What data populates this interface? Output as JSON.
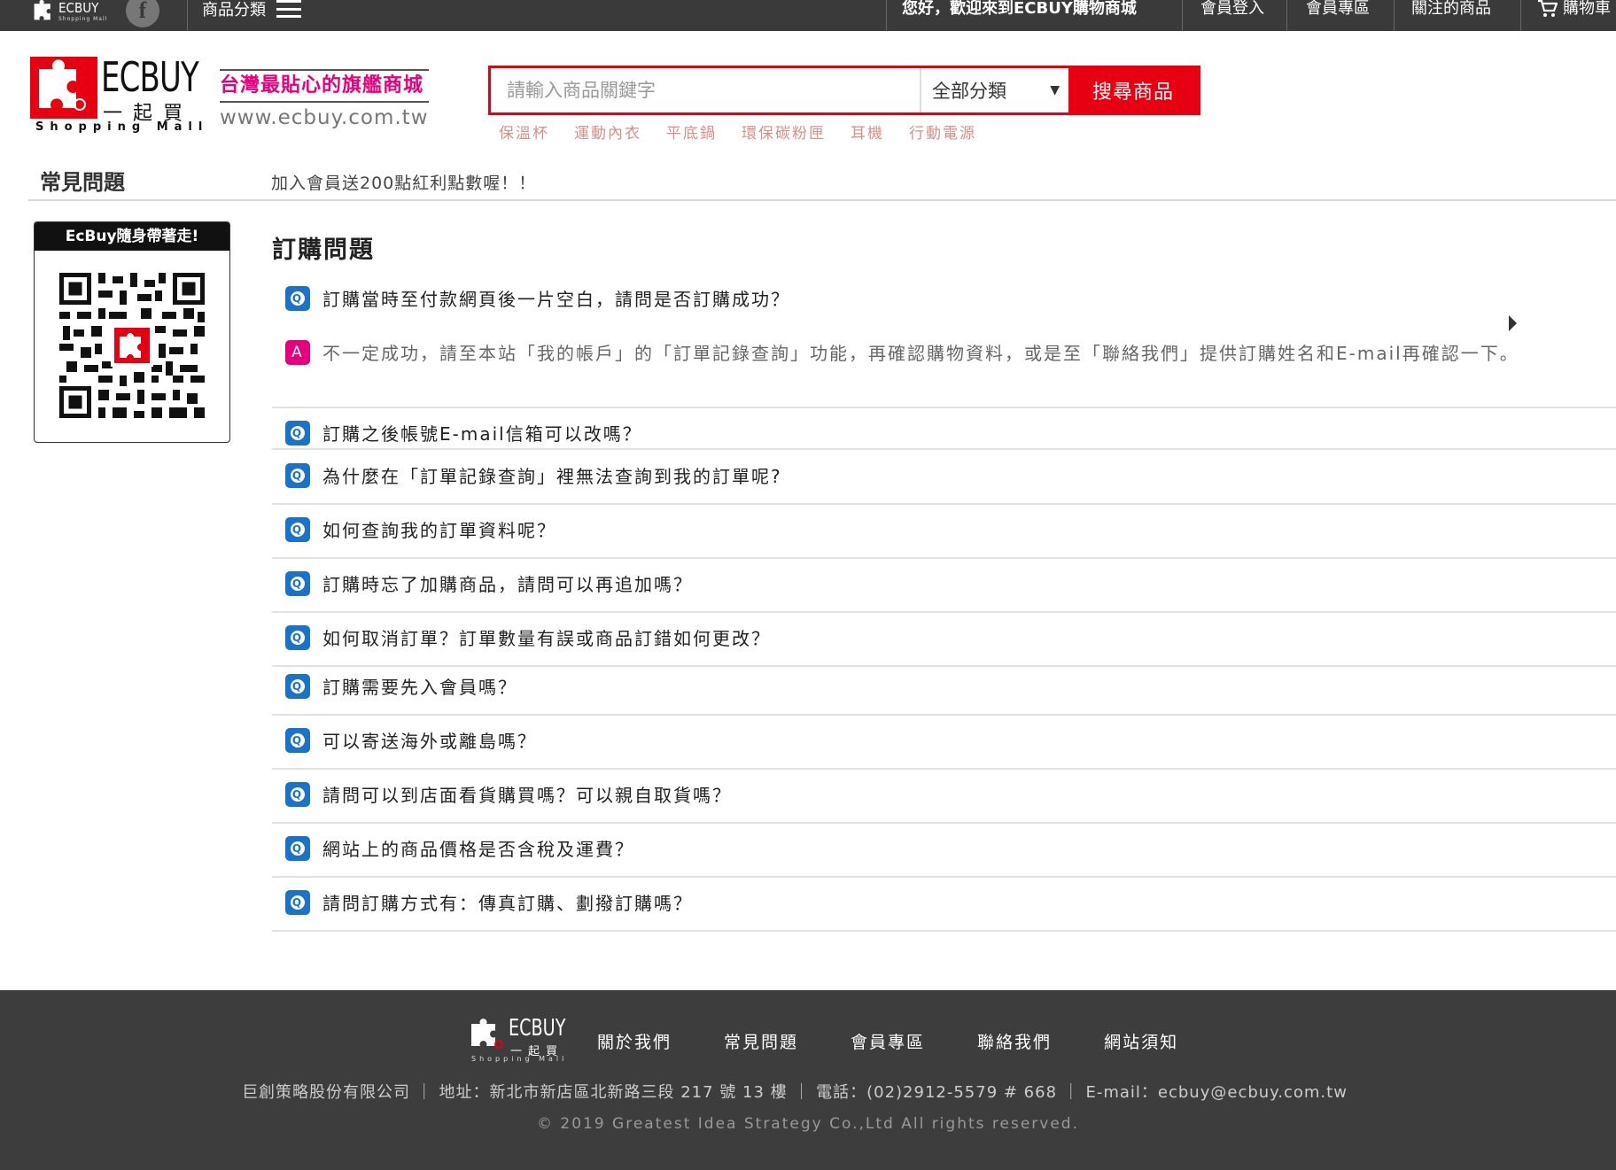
{
  "topbar": {
    "logo_word": "ECBUY",
    "logo_sub": "Shopping Mall",
    "facebook_label": "f",
    "category_label": "商品分類",
    "welcome": "您好，歡迎來到ECBUY購物商城",
    "links": [
      "會員登入",
      "會員專區",
      "關注的商品",
      "購物車"
    ]
  },
  "header": {
    "logo_word": "ECBUY",
    "logo_cn": "一起買",
    "logo_en": "Shopping Mall",
    "slogan": "台灣最貼心的旗艦商城",
    "url": "www.ecbuy.com.tw"
  },
  "search": {
    "placeholder": "請輸入商品關鍵字",
    "category_selected": "全部分類",
    "button_label": "搜尋商品",
    "hot_tags": [
      "保溫杯",
      "運動內衣",
      "平底鍋",
      "環保碳粉匣",
      "耳機",
      "行動電源"
    ]
  },
  "breadcrumb": {
    "section_title": "常見問題",
    "promo": "加入會員送200點紅利點數喔！！"
  },
  "qr": {
    "title": "EcBuy隨身帶著走!"
  },
  "faq": {
    "heading": "訂購問題",
    "badge_q": "Q",
    "badge_a": "A",
    "expanded_answer": "不一定成功，請至本站「我的帳戶」的「訂單記錄查詢」功能，再確認購物資料，或是至「聯絡我們」提供訂購姓名和E-mail再確認一下。",
    "questions": [
      "訂購當時至付款網頁後一片空白，請問是否訂購成功？",
      "訂購之後帳號E-mail信箱可以改嗎？",
      "為什麼在「訂單記錄查詢」裡無法查詢到我的訂單呢?",
      "如何查詢我的訂單資料呢？",
      "訂購時忘了加購商品，請問可以再追加嗎？",
      "如何取消訂單？訂單數量有誤或商品訂錯如何更改？",
      "訂購需要先入會員嗎？",
      "可以寄送海外或離島嗎？",
      "請問可以到店面看貨購買嗎？可以親自取貨嗎？",
      "網站上的商品價格是否含稅及運費？",
      "請問訂購方式有：傳真訂購、劃撥訂購嗎？"
    ]
  },
  "footer": {
    "logo_word": "ECBUY",
    "logo_cn": "一起買",
    "logo_en": "Shopping Mall",
    "nav": [
      "關於我們",
      "常見問題",
      "會員專區",
      "聯絡我們",
      "網站須知"
    ],
    "info": "巨創策略股份有限公司 ｜ 地址：新北市新店區北新路三段 217 號 13 樓 ｜ 電話：(02)2912-5579 # 668 ｜ E-mail：ecbuy@ecbuy.com.tw",
    "copyright": "© 2019 Greatest Idea Strategy Co.,Ltd All rights reserved."
  },
  "colors": {
    "brand_red": "#e60012",
    "slogan_pink": "#e6007e",
    "q_badge_blue": "#1a73c8",
    "topbar_bg": "#3a3a3a",
    "footer_bg": "#3d3d3d"
  }
}
